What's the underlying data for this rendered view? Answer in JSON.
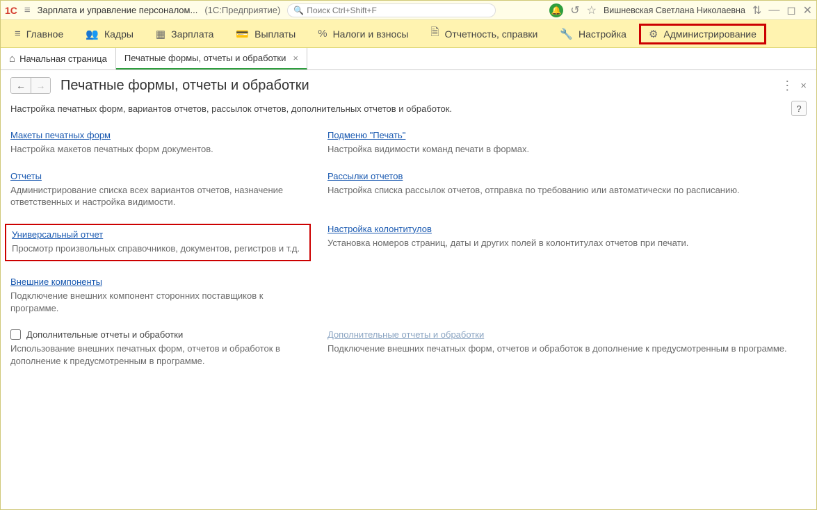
{
  "titlebar": {
    "logo": "1C",
    "app_title": "Зарплата и управление персоналом...",
    "app_sub": "(1С:Предприятие)",
    "search_placeholder": "Поиск Ctrl+Shift+F",
    "user": "Вишневская Светлана Николаевна"
  },
  "menu": [
    {
      "icon": "≡",
      "label": "Главное"
    },
    {
      "icon": "👥",
      "label": "Кадры"
    },
    {
      "icon": "▦",
      "label": "Зарплата"
    },
    {
      "icon": "💳",
      "label": "Выплаты"
    },
    {
      "icon": "%",
      "label": "Налоги и взносы"
    },
    {
      "icon": "🗎",
      "label": "Отчетность, справки"
    },
    {
      "icon": "🔧",
      "label": "Настройка"
    },
    {
      "icon": "⚙",
      "label": "Администрирование"
    }
  ],
  "tabs": {
    "home": "Начальная страница",
    "active": "Печатные формы, отчеты и обработки"
  },
  "page": {
    "title": "Печатные формы, отчеты и обработки",
    "desc": "Настройка печатных форм, вариантов отчетов, рассылок отчетов, дополнительных отчетов и обработок.",
    "help": "?"
  },
  "blocks": {
    "a1_link": "Макеты печатных форм",
    "a1_desc": "Настройка макетов печатных форм документов.",
    "b1_link": "Подменю \"Печать\"",
    "b1_desc": "Настройка видимости команд печати в формах.",
    "a2_link": "Отчеты",
    "a2_desc": "Администрирование списка всех вариантов отчетов, назначение ответственных и настройка видимости.",
    "b2_link": "Рассылки отчетов",
    "b2_desc": "Настройка списка рассылок отчетов, отправка по требованию или автоматически по расписанию.",
    "a3_link": "Универсальный отчет",
    "a3_desc": "Просмотр произвольных справочников, документов, регистров и т.д.",
    "b3_link": "Настройка колонтитулов",
    "b3_desc": "Установка номеров страниц, даты и других полей в колонтитулах отчетов при печати.",
    "a4_link": "Внешние компоненты",
    "a4_desc": "Подключение внешних компонент сторонних поставщиков к программе.",
    "a5_check": "Дополнительные отчеты и обработки",
    "a5_desc": "Использование внешних печатных форм, отчетов и обработок в дополнение к предусмотренным в программе.",
    "b5_link": "Дополнительные отчеты и обработки",
    "b5_desc": "Подключение внешних печатных форм, отчетов и обработок в дополнение к предусмотренным в программе."
  }
}
